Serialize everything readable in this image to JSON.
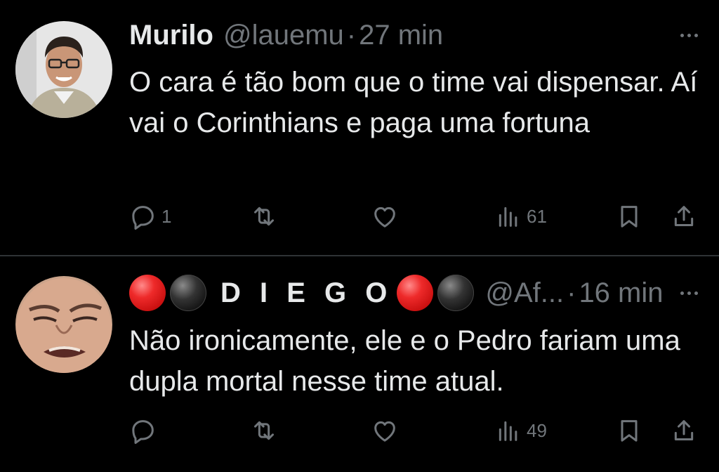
{
  "tweets": [
    {
      "name": "Murilo",
      "handle": "@lauemu",
      "separator": "·",
      "time": "27 min",
      "text": "O cara é tão bom que o time vai dispensar. Aí vai o Corinthians e paga uma fortuna",
      "replies": "1",
      "retweets": "",
      "likes": "",
      "views": "61",
      "icons": [
        "reply-icon",
        "retweet-icon",
        "like-icon",
        "views-icon",
        "bookmark-icon",
        "share-icon",
        "more-icon"
      ]
    },
    {
      "name": "D I E G O",
      "name_emojis": [
        "red-circle",
        "black-circle",
        "red-circle",
        "black-circle"
      ],
      "handle": "@Af...",
      "separator": "·",
      "time": "16 min",
      "text": "Não ironicamente, ele e o Pedro fariam uma dupla mortal nesse time atual.",
      "replies": "",
      "retweets": "",
      "likes": "",
      "views": "49",
      "icons": [
        "reply-icon",
        "retweet-icon",
        "like-icon",
        "views-icon",
        "bookmark-icon",
        "share-icon",
        "more-icon"
      ]
    }
  ],
  "colors": {
    "background": "#000000",
    "primary_text": "#e7e9ea",
    "secondary_text": "#71767b",
    "divider": "#2f3336"
  }
}
